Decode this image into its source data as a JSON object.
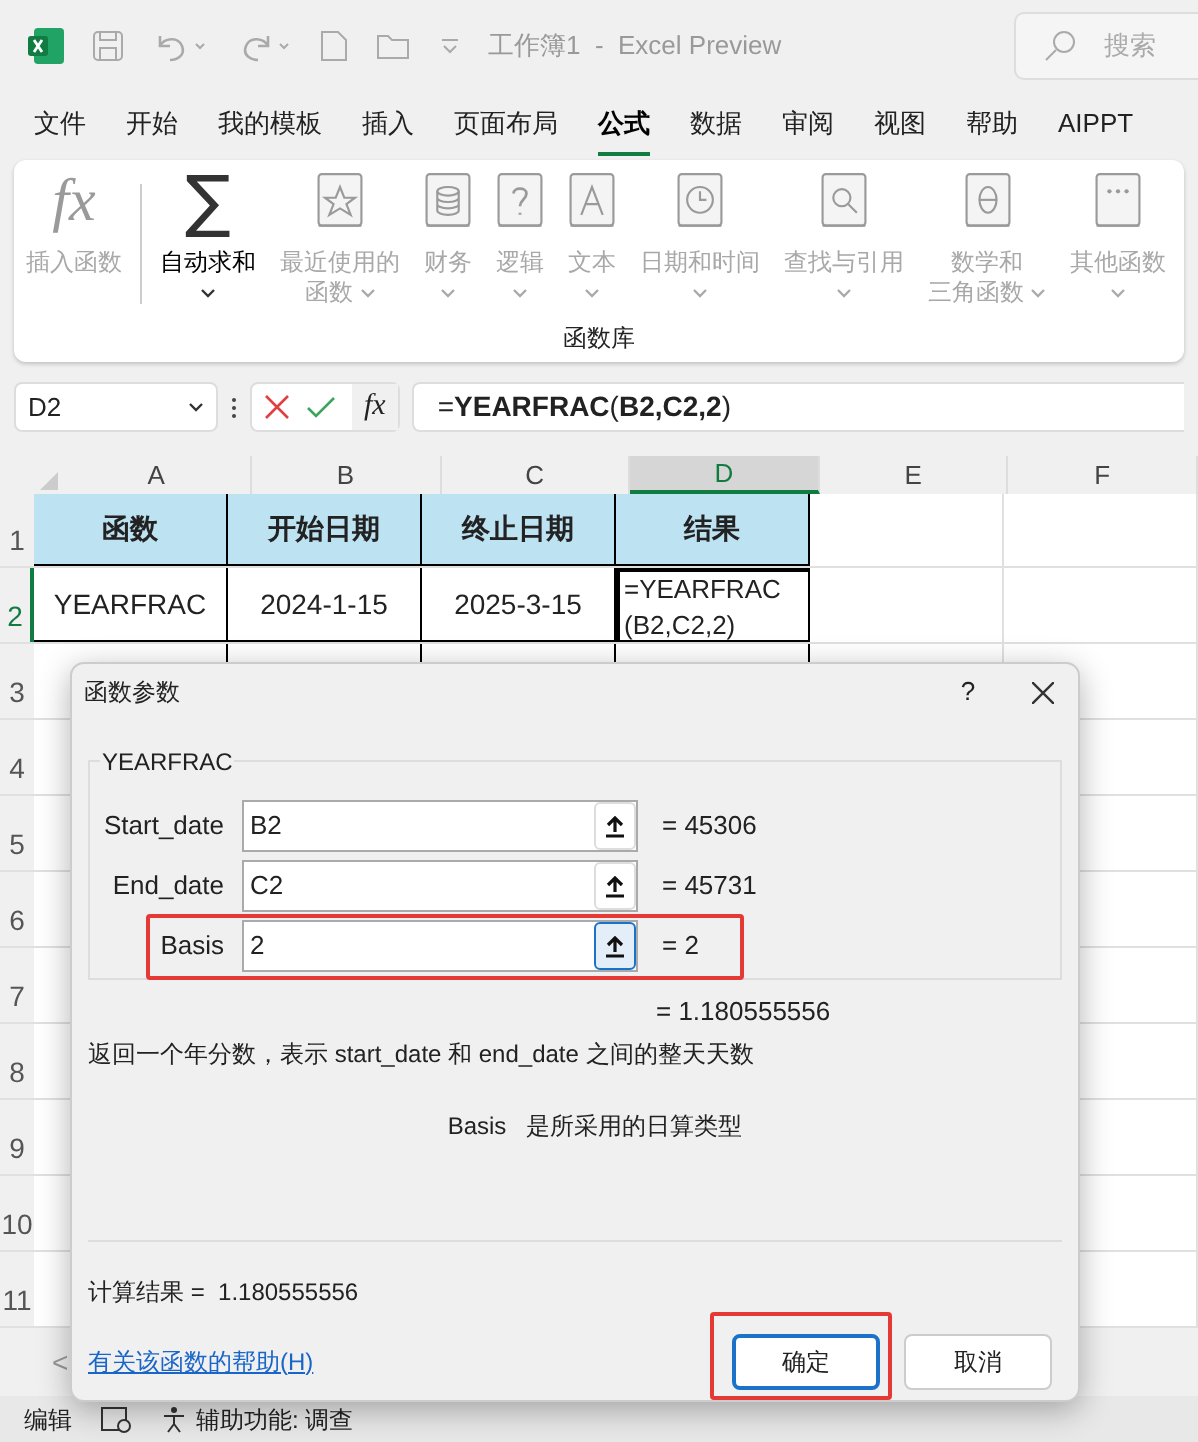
{
  "title_bar": {
    "title": "工作簿1  -  Excel Preview",
    "search_placeholder": "搜索"
  },
  "menu_tabs": [
    {
      "label": "文件",
      "selected": false
    },
    {
      "label": "开始",
      "selected": false
    },
    {
      "label": "我的模板",
      "selected": false
    },
    {
      "label": "插入",
      "selected": false
    },
    {
      "label": "页面布局",
      "selected": false
    },
    {
      "label": "公式",
      "selected": true
    },
    {
      "label": "数据",
      "selected": false
    },
    {
      "label": "审阅",
      "selected": false
    },
    {
      "label": "视图",
      "selected": false
    },
    {
      "label": "帮助",
      "selected": false
    },
    {
      "label": "AIPPT",
      "selected": false
    }
  ],
  "ribbon": {
    "group_label": "函数库",
    "items": [
      {
        "kind": "fx",
        "glyph": "fx",
        "label": "插入函数",
        "disabled": true,
        "dropdown": false
      },
      {
        "kind": "sigma",
        "glyph": "∑",
        "label": "自动求和",
        "disabled": false,
        "dropdown": true
      },
      {
        "kind": "star",
        "label": "最近使用的",
        "label2": "函数",
        "disabled": true,
        "dropdown": true
      },
      {
        "kind": "coins",
        "label": "财务",
        "disabled": true,
        "dropdown": true
      },
      {
        "kind": "question",
        "label": "逻辑",
        "disabled": true,
        "dropdown": true
      },
      {
        "kind": "letter",
        "label": "文本",
        "disabled": true,
        "dropdown": true
      },
      {
        "kind": "clock",
        "label": "日期和时间",
        "disabled": true,
        "dropdown": true
      },
      {
        "kind": "magnifier",
        "label": "查找与引用",
        "disabled": true,
        "dropdown": true
      },
      {
        "kind": "theta",
        "label": "数学和",
        "label2": "三角函数",
        "disabled": true,
        "dropdown": true
      },
      {
        "kind": "dots",
        "label": "其他函数",
        "disabled": true,
        "dropdown": true
      }
    ]
  },
  "formula_bar": {
    "name_box": "D2",
    "fx": "fx",
    "formula": "=**YEARFRAC**(**B2,C2,2**)"
  },
  "sheet": {
    "columns": [
      {
        "label": "A",
        "selected": false
      },
      {
        "label": "B",
        "selected": false
      },
      {
        "label": "C",
        "selected": false
      },
      {
        "label": "D",
        "selected": true
      },
      {
        "label": "E",
        "selected": false
      },
      {
        "label": "F",
        "selected": false
      }
    ],
    "rows": [
      {
        "number": "1",
        "selected": false,
        "cells": [
          "函数",
          "开始日期",
          "终止日期",
          "结果"
        ]
      },
      {
        "number": "2",
        "selected": true,
        "cells": [
          "YEARFRAC",
          "2024-1-15",
          "2025-3-15",
          "=YEARFRAC(B2,C2,2)"
        ]
      },
      {
        "number": "3",
        "selected": false,
        "cells": []
      },
      {
        "number": "4",
        "selected": false,
        "cells": []
      },
      {
        "number": "5",
        "selected": false,
        "cells": []
      },
      {
        "number": "6",
        "selected": false,
        "cells": []
      },
      {
        "number": "7",
        "selected": false,
        "cells": []
      },
      {
        "number": "8",
        "selected": false,
        "cells": []
      },
      {
        "number": "9",
        "selected": false,
        "cells": []
      },
      {
        "number": "10",
        "selected": false,
        "cells": []
      },
      {
        "number": "11",
        "selected": false,
        "cells": []
      }
    ]
  },
  "sheet_nav": "<",
  "dialog": {
    "title": "函数参数",
    "help": "?",
    "function_name": "YEARFRAC",
    "args": [
      {
        "label": "Start_date",
        "value": "B2",
        "result": "= 45306",
        "highlighted": false,
        "focused": false
      },
      {
        "label": "End_date",
        "value": "C2",
        "result": "= 45731",
        "highlighted": false,
        "focused": false
      },
      {
        "label": "Basis",
        "value": "2",
        "result": "= 2",
        "highlighted": true,
        "focused": true
      }
    ],
    "formula_result": "= 1.180555556",
    "description": "返回一个年分数，表示 start_date 和 end_date 之间的整天天数",
    "arg_help": {
      "name": "Basis",
      "text": "是所采用的日算类型"
    },
    "computed_label": "计算结果 =",
    "computed_value": "1.180555556",
    "help_link": "有关该函数的帮助(H)",
    "buttons": [
      {
        "label": "确定",
        "default": true,
        "highlighted": true
      },
      {
        "label": "取消",
        "default": false,
        "highlighted": false
      }
    ]
  },
  "status_bar": {
    "mode": "编辑",
    "accessibility": "辅助功能: 调查"
  }
}
